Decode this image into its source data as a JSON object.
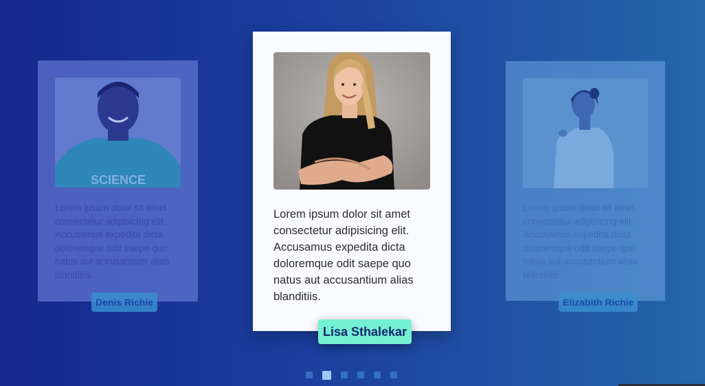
{
  "cards": [
    {
      "name": "Denis Richie",
      "quote": "Lorem ipsum dolor sit amet consectetur adipisicing elit. Accusamus expedita dicta doloremque odit saepe quo natus aut accusantium alias blanditiis.",
      "photo_icon": "person-photo"
    },
    {
      "name": "Lisa Sthalekar",
      "quote": "Lorem ipsum dolor sit amet consectetur adipisicing elit. Accusamus expedita dicta doloremque odit saepe quo natus aut accusantium alias blanditiis.",
      "photo_icon": "person-photo"
    },
    {
      "name": "Elizabith Richie",
      "quote": "Lorem ipsum dolor sit amet consectetur adipisicing elit. Accusamus expedita dicta doloremque odit saepe quo natus aut accusantium alias blanditiis.",
      "photo_icon": "person-photo"
    }
  ],
  "photo_texts": {
    "shirt_text": "SCIENCE"
  },
  "pagination": {
    "count": 6,
    "active_index": 1
  },
  "colors": {
    "accent_tag": "#74f0d2",
    "active_dot": "#9ccaf7"
  }
}
